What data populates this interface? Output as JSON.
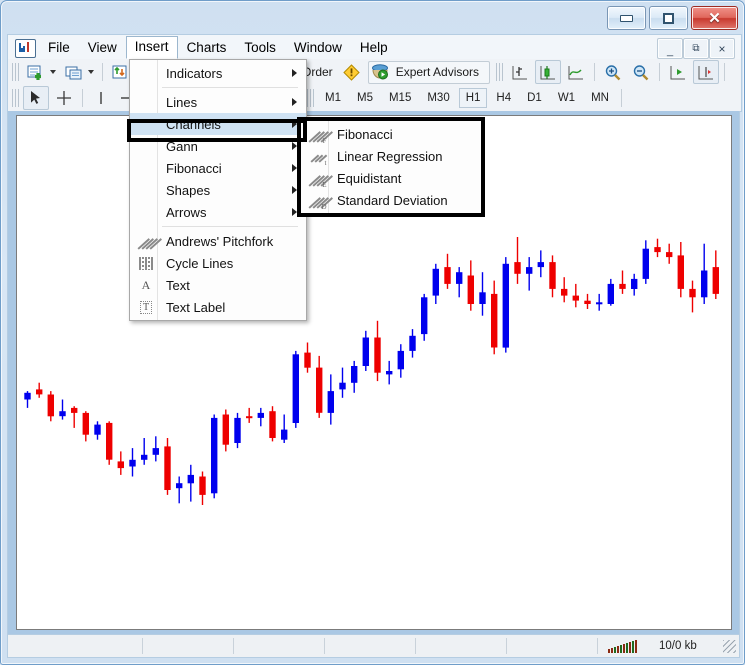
{
  "window": {
    "controls": [
      {
        "name": "minimize",
        "glyph": "minimize-icon"
      },
      {
        "name": "maximize",
        "glyph": "maximize-icon"
      },
      {
        "name": "close",
        "glyph": "close-icon",
        "label": "✕"
      }
    ],
    "mdi_controls": [
      "_",
      "⧉",
      "×"
    ]
  },
  "menubar": {
    "items": [
      {
        "label": "File",
        "open": false
      },
      {
        "label": "View",
        "open": false
      },
      {
        "label": "Insert",
        "open": true
      },
      {
        "label": "Charts",
        "open": false
      },
      {
        "label": "Tools",
        "open": false
      },
      {
        "label": "Window",
        "open": false
      },
      {
        "label": "Help",
        "open": false
      }
    ]
  },
  "toolbar": {
    "new_order_label": "w Order",
    "expert_advisors_label": "Expert Advisors",
    "buttons": [
      {
        "name": "new-chart-button",
        "icon": "new-chart-icon"
      },
      {
        "name": "new-chart-dropdown",
        "icon": "chevron-down-icon"
      },
      {
        "name": "profiles-button",
        "icon": "profiles-icon"
      },
      {
        "name": "profiles-dropdown",
        "icon": "chevron-down-icon"
      },
      {
        "name": "market-watch-button",
        "icon": "market-watch-icon"
      },
      {
        "name": "bar-chart-button",
        "icon": "bar-chart-icon"
      },
      {
        "name": "candlestick-chart-button",
        "icon": "candlestick-icon"
      },
      {
        "name": "line-chart-button",
        "icon": "line-chart-icon"
      },
      {
        "name": "zoom-in-button",
        "icon": "zoom-in-icon"
      },
      {
        "name": "zoom-out-button",
        "icon": "zoom-out-icon"
      },
      {
        "name": "auto-scroll-button",
        "icon": "auto-scroll-icon"
      },
      {
        "name": "chart-shift-button",
        "icon": "chart-shift-icon"
      }
    ],
    "cursor_tools": [
      {
        "name": "cursor-tool",
        "icon": "arrow-cursor-icon",
        "active": true
      },
      {
        "name": "crosshair-tool",
        "icon": "crosshair-icon",
        "active": false
      },
      {
        "name": "vertical-line-tool",
        "icon": "vertical-line-icon",
        "active": false
      },
      {
        "name": "horizontal-line-tool",
        "icon": "horizontal-line-icon",
        "active": false
      }
    ],
    "timeframes": [
      {
        "label": "M1",
        "selected": false
      },
      {
        "label": "M5",
        "selected": false
      },
      {
        "label": "M15",
        "selected": false
      },
      {
        "label": "M30",
        "selected": false
      },
      {
        "label": "H1",
        "selected": true
      },
      {
        "label": "H4",
        "selected": false
      },
      {
        "label": "D1",
        "selected": false
      },
      {
        "label": "W1",
        "selected": false
      },
      {
        "label": "MN",
        "selected": false
      }
    ]
  },
  "insert_menu": {
    "items": [
      {
        "label": "Indicators",
        "icon": null,
        "submenu": true,
        "divider_after": true,
        "highlighted": false
      },
      {
        "label": "Lines",
        "icon": null,
        "submenu": true,
        "divider_after": false,
        "highlighted": false
      },
      {
        "label": "Channels",
        "icon": null,
        "submenu": true,
        "divider_after": false,
        "highlighted": true
      },
      {
        "label": "Gann",
        "icon": null,
        "submenu": true,
        "divider_after": false,
        "highlighted": false
      },
      {
        "label": "Fibonacci",
        "icon": null,
        "submenu": true,
        "divider_after": false,
        "highlighted": false
      },
      {
        "label": "Shapes",
        "icon": null,
        "submenu": true,
        "divider_after": false,
        "highlighted": false
      },
      {
        "label": "Arrows",
        "icon": null,
        "submenu": true,
        "divider_after": true,
        "highlighted": false
      },
      {
        "label": "Andrews' Pitchfork",
        "icon": "pitchfork-icon",
        "submenu": false,
        "divider_after": false,
        "highlighted": false
      },
      {
        "label": "Cycle Lines",
        "icon": "cycle-lines-icon",
        "submenu": false,
        "divider_after": false,
        "highlighted": false
      },
      {
        "label": "Text",
        "icon": "text-icon",
        "submenu": false,
        "divider_after": false,
        "highlighted": false
      },
      {
        "label": "Text Label",
        "icon": "text-label-icon",
        "submenu": false,
        "divider_after": false,
        "highlighted": false
      }
    ]
  },
  "channels_submenu": {
    "items": [
      {
        "label": "Fibonacci",
        "icon": "channel-fibonacci-icon",
        "sub": "F"
      },
      {
        "label": "Linear Regression",
        "icon": "channel-linear-regression-icon",
        "sub": "t"
      },
      {
        "label": "Equidistant",
        "icon": "channel-equidistant-icon",
        "sub": "E"
      },
      {
        "label": "Standard Deviation",
        "icon": "channel-standard-deviation-icon",
        "sub": "D"
      }
    ]
  },
  "statusbar": {
    "traffic_label": "network-signal-icon",
    "kb_label": "10/0 kb"
  },
  "colors": {
    "bull": "#0000ee",
    "bear": "#ee0000",
    "chart_bg": "#ffffff",
    "accent": "#cfe2f3",
    "window_frame": "#6f9dc9"
  },
  "chart_data": {
    "type": "candlestick",
    "title": "",
    "xlabel": "",
    "ylabel": "",
    "bull_color": "#0000ee",
    "bear_color": "#ee0000",
    "price_min": 0,
    "price_max": 100,
    "candles": [
      {
        "o": 31.5,
        "h": 34.0,
        "l": 29.0,
        "c": 33.5
      },
      {
        "o": 34.5,
        "h": 36.5,
        "l": 32.0,
        "c": 33.0
      },
      {
        "o": 33.0,
        "h": 34.0,
        "l": 25.0,
        "c": 26.5
      },
      {
        "o": 26.5,
        "h": 31.5,
        "l": 25.5,
        "c": 28.0
      },
      {
        "o": 29.0,
        "h": 29.5,
        "l": 23.0,
        "c": 27.5
      },
      {
        "o": 27.5,
        "h": 28.0,
        "l": 19.0,
        "c": 21.0
      },
      {
        "o": 21.0,
        "h": 25.0,
        "l": 19.5,
        "c": 24.0
      },
      {
        "o": 24.5,
        "h": 25.0,
        "l": 12.0,
        "c": 13.5
      },
      {
        "o": 13.0,
        "h": 16.0,
        "l": 9.0,
        "c": 11.0
      },
      {
        "o": 11.5,
        "h": 17.0,
        "l": 8.5,
        "c": 13.5
      },
      {
        "o": 13.5,
        "h": 20.0,
        "l": 12.0,
        "c": 15.0
      },
      {
        "o": 15.0,
        "h": 20.5,
        "l": 13.0,
        "c": 17.0
      },
      {
        "o": 17.5,
        "h": 20.0,
        "l": 3.0,
        "c": 4.5
      },
      {
        "o": 5.0,
        "h": 8.5,
        "l": 0.5,
        "c": 6.5
      },
      {
        "o": 6.5,
        "h": 12.0,
        "l": 1.0,
        "c": 9.0
      },
      {
        "o": 8.5,
        "h": 10.0,
        "l": 0.0,
        "c": 3.0
      },
      {
        "o": 3.5,
        "h": 27.0,
        "l": 2.0,
        "c": 26.0
      },
      {
        "o": 27.0,
        "h": 28.5,
        "l": 16.0,
        "c": 18.0
      },
      {
        "o": 18.5,
        "h": 27.5,
        "l": 17.0,
        "c": 26.0
      },
      {
        "o": 26.5,
        "h": 29.0,
        "l": 24.5,
        "c": 26.0
      },
      {
        "o": 26.0,
        "h": 29.0,
        "l": 23.5,
        "c": 27.5
      },
      {
        "o": 28.0,
        "h": 29.5,
        "l": 19.0,
        "c": 20.0
      },
      {
        "o": 19.5,
        "h": 27.0,
        "l": 18.5,
        "c": 22.5
      },
      {
        "o": 24.5,
        "h": 46.0,
        "l": 23.0,
        "c": 45.0
      },
      {
        "o": 45.5,
        "h": 48.5,
        "l": 39.5,
        "c": 41.0
      },
      {
        "o": 41.0,
        "h": 44.5,
        "l": 26.0,
        "c": 27.5
      },
      {
        "o": 27.5,
        "h": 39.0,
        "l": 24.0,
        "c": 34.0
      },
      {
        "o": 34.5,
        "h": 41.0,
        "l": 32.0,
        "c": 36.5
      },
      {
        "o": 36.5,
        "h": 43.0,
        "l": 33.5,
        "c": 41.5
      },
      {
        "o": 41.5,
        "h": 52.0,
        "l": 40.0,
        "c": 50.0
      },
      {
        "o": 50.0,
        "h": 55.0,
        "l": 37.0,
        "c": 39.5
      },
      {
        "o": 39.0,
        "h": 43.0,
        "l": 36.0,
        "c": 40.0
      },
      {
        "o": 40.5,
        "h": 48.0,
        "l": 38.0,
        "c": 46.0
      },
      {
        "o": 46.0,
        "h": 52.5,
        "l": 44.0,
        "c": 50.5
      },
      {
        "o": 51.0,
        "h": 63.0,
        "l": 49.0,
        "c": 62.0
      },
      {
        "o": 62.5,
        "h": 72.0,
        "l": 60.0,
        "c": 70.5
      },
      {
        "o": 71.0,
        "h": 75.0,
        "l": 64.5,
        "c": 66.0
      },
      {
        "o": 66.0,
        "h": 71.0,
        "l": 62.0,
        "c": 69.5
      },
      {
        "o": 68.5,
        "h": 73.0,
        "l": 58.0,
        "c": 60.0
      },
      {
        "o": 60.0,
        "h": 69.5,
        "l": 56.5,
        "c": 63.5
      },
      {
        "o": 63.0,
        "h": 67.0,
        "l": 45.0,
        "c": 47.0
      },
      {
        "o": 47.0,
        "h": 74.0,
        "l": 45.5,
        "c": 72.0
      },
      {
        "o": 72.5,
        "h": 80.0,
        "l": 66.0,
        "c": 69.0
      },
      {
        "o": 69.0,
        "h": 74.0,
        "l": 64.0,
        "c": 71.0
      },
      {
        "o": 71.0,
        "h": 76.0,
        "l": 68.0,
        "c": 72.5
      },
      {
        "o": 72.5,
        "h": 74.5,
        "l": 62.0,
        "c": 64.5
      },
      {
        "o": 64.5,
        "h": 68.0,
        "l": 60.5,
        "c": 62.5
      },
      {
        "o": 62.5,
        "h": 66.0,
        "l": 59.0,
        "c": 61.0
      },
      {
        "o": 61.0,
        "h": 63.0,
        "l": 58.5,
        "c": 60.0
      },
      {
        "o": 60.0,
        "h": 63.0,
        "l": 58.0,
        "c": 60.5
      },
      {
        "o": 60.0,
        "h": 67.5,
        "l": 59.5,
        "c": 66.0
      },
      {
        "o": 66.0,
        "h": 70.0,
        "l": 63.0,
        "c": 64.5
      },
      {
        "o": 64.5,
        "h": 69.0,
        "l": 62.5,
        "c": 67.5
      },
      {
        "o": 67.5,
        "h": 79.0,
        "l": 66.0,
        "c": 76.5
      },
      {
        "o": 77.0,
        "h": 79.5,
        "l": 74.0,
        "c": 75.5
      },
      {
        "o": 75.5,
        "h": 78.0,
        "l": 72.0,
        "c": 74.0
      },
      {
        "o": 74.5,
        "h": 78.5,
        "l": 62.0,
        "c": 64.5
      },
      {
        "o": 64.5,
        "h": 67.0,
        "l": 57.5,
        "c": 62.0
      },
      {
        "o": 62.0,
        "h": 78.0,
        "l": 60.0,
        "c": 70.0
      },
      {
        "o": 71.0,
        "h": 76.0,
        "l": 61.5,
        "c": 63.0
      }
    ]
  }
}
